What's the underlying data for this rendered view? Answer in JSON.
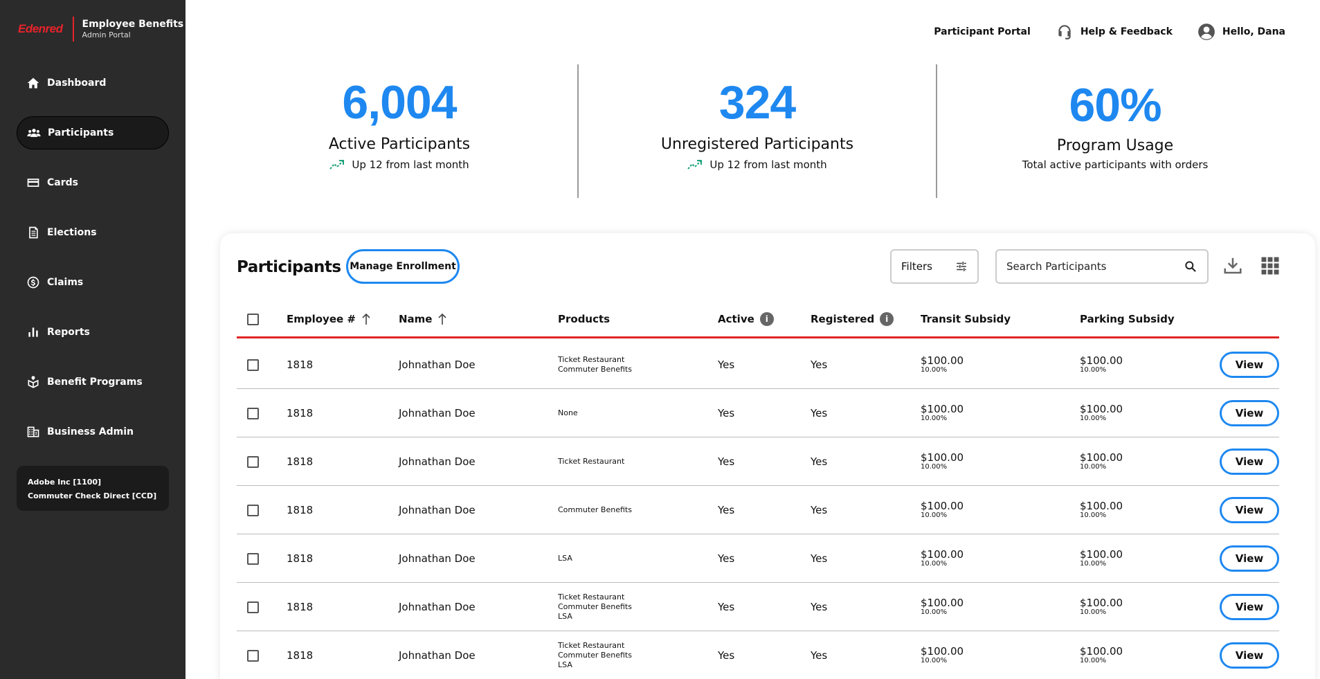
{
  "brand": {
    "logo_text": "Edenred",
    "title": "Employee Benefits",
    "subtitle": "Admin Portal"
  },
  "sidebar": {
    "items": [
      {
        "label": "Dashboard",
        "icon": "home-icon"
      },
      {
        "label": "Participants",
        "icon": "participants-icon",
        "active": true
      },
      {
        "label": "Cards",
        "icon": "card-icon"
      },
      {
        "label": "Elections",
        "icon": "elections-icon"
      },
      {
        "label": "Claims",
        "icon": "dollar-circle-icon"
      },
      {
        "label": "Reports",
        "icon": "bar-chart-icon"
      },
      {
        "label": "Benefit Programs",
        "icon": "benefit-box-icon"
      },
      {
        "label": "Business Admin",
        "icon": "building-icon"
      }
    ],
    "account": {
      "line1": "Adobe Inc [1100]",
      "line2": "Commuter Check Direct [CCD]"
    }
  },
  "topbar": {
    "participant_portal": "Participant Portal",
    "help": "Help & Feedback",
    "greeting": "Hello, Dana"
  },
  "stats": [
    {
      "value": "6,004",
      "label": "Active Participants",
      "sub": "Up 12 from last month"
    },
    {
      "value": "324",
      "label": "Unregistered Participants",
      "sub": "Up 12 from last month"
    },
    {
      "value": "60%",
      "label": "Program Usage",
      "sub": "Total active participants with orders"
    }
  ],
  "participants": {
    "title": "Participants",
    "manage_label": "Manage Enrollment",
    "filters_label": "Filters",
    "search_placeholder": "Search Participants",
    "columns": {
      "employee": "Employee #",
      "name": "Name",
      "products": "Products",
      "active": "Active",
      "registered": "Registered",
      "transit": "Transit Subsidy",
      "parking": "Parking Subsidy"
    },
    "view_label": "View",
    "rows": [
      {
        "emp": "1818",
        "name": "Johnathan Doe",
        "products": [
          "Ticket Restaurant",
          "Commuter Benefits"
        ],
        "active": "Yes",
        "registered": "Yes",
        "transit_amt": "$100.00",
        "transit_pct": "10.00%",
        "parking_amt": "$100.00",
        "parking_pct": "10.00%"
      },
      {
        "emp": "1818",
        "name": "Johnathan Doe",
        "products": [
          "None"
        ],
        "active": "Yes",
        "registered": "Yes",
        "transit_amt": "$100.00",
        "transit_pct": "10.00%",
        "parking_amt": "$100.00",
        "parking_pct": "10.00%"
      },
      {
        "emp": "1818",
        "name": "Johnathan Doe",
        "products": [
          "Ticket Restaurant"
        ],
        "active": "Yes",
        "registered": "Yes",
        "transit_amt": "$100.00",
        "transit_pct": "10.00%",
        "parking_amt": "$100.00",
        "parking_pct": "10.00%"
      },
      {
        "emp": "1818",
        "name": "Johnathan Doe",
        "products": [
          "Commuter Benefits"
        ],
        "active": "Yes",
        "registered": "Yes",
        "transit_amt": "$100.00",
        "transit_pct": "10.00%",
        "parking_amt": "$100.00",
        "parking_pct": "10.00%"
      },
      {
        "emp": "1818",
        "name": "Johnathan Doe",
        "products": [
          "LSA"
        ],
        "active": "Yes",
        "registered": "Yes",
        "transit_amt": "$100.00",
        "transit_pct": "10.00%",
        "parking_amt": "$100.00",
        "parking_pct": "10.00%"
      },
      {
        "emp": "1818",
        "name": "Johnathan Doe",
        "products": [
          "Ticket Restaurant",
          "Commuter Benefits",
          "LSA"
        ],
        "active": "Yes",
        "registered": "Yes",
        "transit_amt": "$100.00",
        "transit_pct": "10.00%",
        "parking_amt": "$100.00",
        "parking_pct": "10.00%"
      },
      {
        "emp": "1818",
        "name": "Johnathan Doe",
        "products": [
          "Ticket Restaurant",
          "Commuter Benefits",
          "LSA"
        ],
        "active": "Yes",
        "registered": "Yes",
        "transit_amt": "$100.00",
        "transit_pct": "10.00%",
        "parking_amt": "$100.00",
        "parking_pct": "10.00%"
      }
    ]
  },
  "colors": {
    "accent": "#1e88f0",
    "brand_red": "#e8232b",
    "sidebar_bg": "#2b2b2b",
    "trend_green": "#1aa37a"
  }
}
